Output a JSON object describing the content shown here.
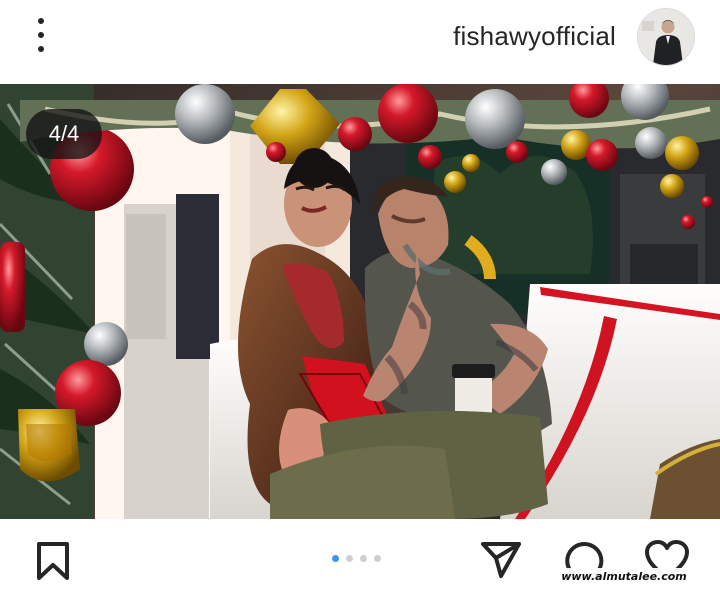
{
  "header": {
    "username": "fishawyofficial",
    "avatar_icon": "profile-avatar",
    "more_icon": "more-options-icon"
  },
  "post": {
    "counter": "4/4",
    "current_index": 4,
    "total_images": 4
  },
  "actions": {
    "icons": [
      "bookmark-icon",
      "share-icon",
      "comment-icon",
      "heart-icon"
    ],
    "pagination_dots": 4,
    "active_dot": 1,
    "accent_color": "#3897f0"
  },
  "watermark": {
    "text": "www.almutalee.com"
  }
}
